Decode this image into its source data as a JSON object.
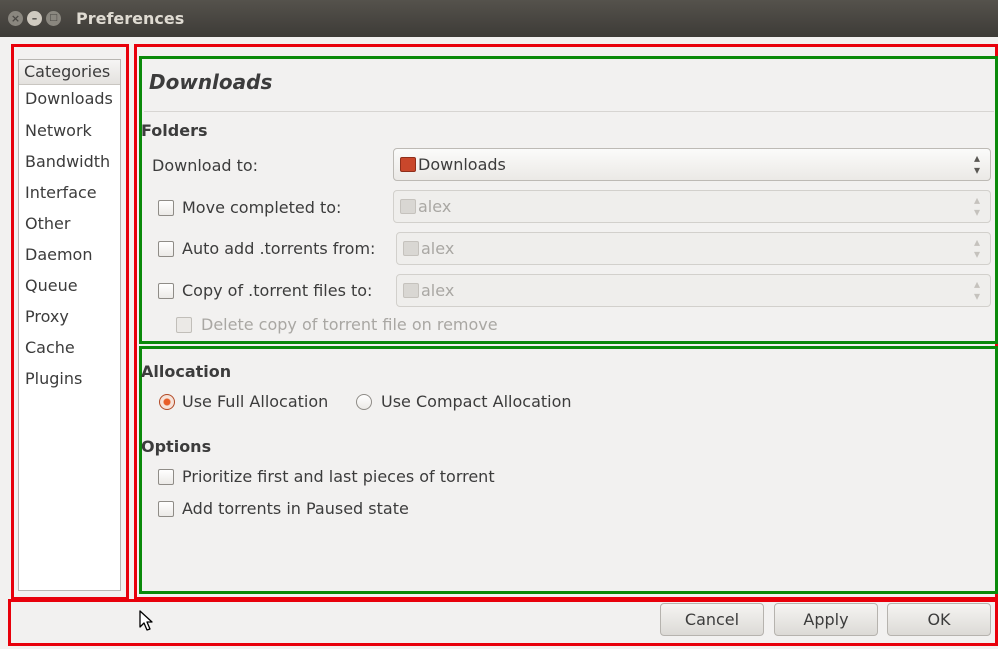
{
  "window": {
    "title": "Preferences"
  },
  "categories": {
    "header": "Categories",
    "items": [
      "Downloads",
      "Network",
      "Bandwidth",
      "Interface",
      "Other",
      "Daemon",
      "Queue",
      "Proxy",
      "Cache",
      "Plugins"
    ]
  },
  "page": {
    "title": "Downloads"
  },
  "folders": {
    "label": "Folders",
    "download_to_label": "Download to:",
    "download_to_value": "Downloads",
    "move_completed_label": "Move completed to:",
    "move_completed_value": "alex",
    "auto_add_label": "Auto add .torrents from:",
    "auto_add_value": "alex",
    "copy_torrent_label": "Copy of .torrent files to:",
    "copy_torrent_value": "alex",
    "delete_copy_label": "Delete copy of torrent file on remove"
  },
  "allocation": {
    "label": "Allocation",
    "full_label": "Use Full Allocation",
    "compact_label": "Use Compact Allocation",
    "selected": "full"
  },
  "options": {
    "label": "Options",
    "prioritize_label": "Prioritize first and last pieces of torrent",
    "paused_label": "Add torrents in Paused state"
  },
  "buttons": {
    "cancel": "Cancel",
    "apply": "Apply",
    "ok": "OK"
  },
  "colors": {
    "annotation_red": "#e8000b",
    "annotation_green": "#0a8a0a",
    "radio_accent": "#e85d27"
  },
  "icons": {
    "folder_icon": "folder-download-icon",
    "home_folder_icon": "home-folder-icon"
  }
}
